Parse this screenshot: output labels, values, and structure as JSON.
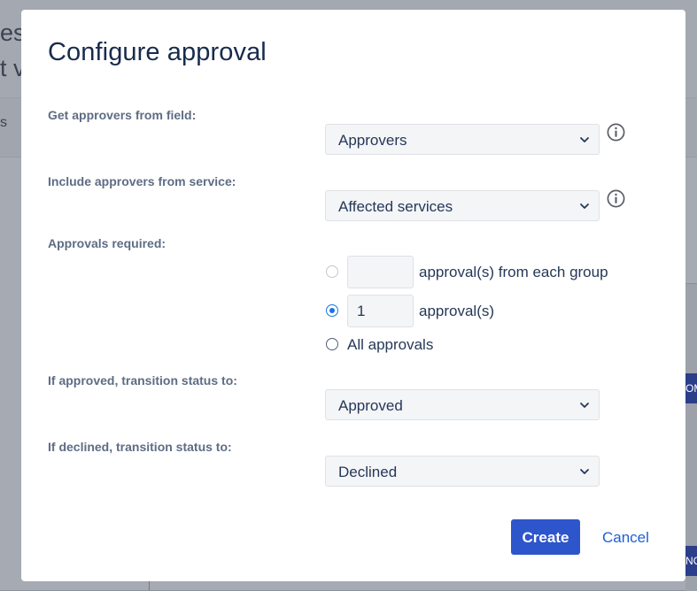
{
  "background": {
    "heading_line1": "es",
    "heading_line2": "t v",
    "sub_char": "s",
    "badge1": "OM",
    "badge2": "NC"
  },
  "modal": {
    "title": "Configure approval",
    "approvers_field": {
      "label": "Get approvers from field:",
      "value": "Approvers"
    },
    "approvers_service": {
      "label": "Include approvers from service:",
      "value": "Affected services"
    },
    "approvals_required": {
      "label": "Approvals required:",
      "options": [
        {
          "input_value": "",
          "text": "approval(s) from each group",
          "checked": false,
          "disabled": true
        },
        {
          "input_value": "1",
          "text": "approval(s)",
          "checked": true,
          "disabled": false
        },
        {
          "text": "All approvals",
          "checked": false,
          "disabled": false
        }
      ]
    },
    "approved_status": {
      "label": "If approved, transition status to:",
      "value": "Approved"
    },
    "declined_status": {
      "label": "If declined, transition status to:",
      "value": "Declined"
    },
    "create_label": "Create",
    "cancel_label": "Cancel"
  },
  "colors": {
    "primary": "#2d55cc",
    "link": "#1f5fd1",
    "title": "#172b4d",
    "label": "#5e6c84",
    "radio_checked": "#1a73e8"
  },
  "icons": [
    "chevron-down-icon",
    "info-icon"
  ]
}
